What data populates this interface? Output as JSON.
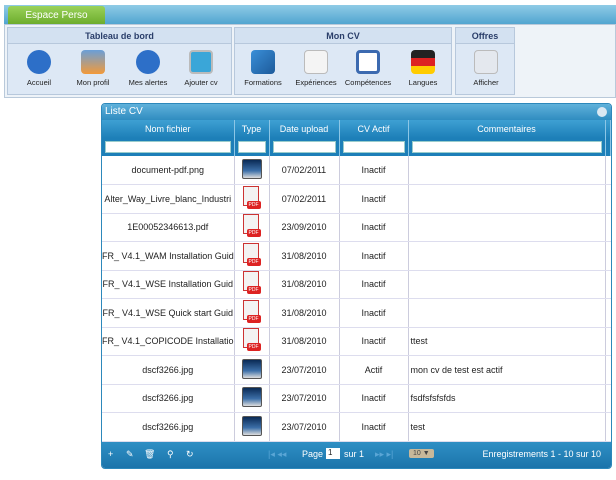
{
  "tab": "Espace Perso",
  "groups": [
    {
      "title": "Tableau de bord",
      "buttons": [
        "Accueil",
        "Mon profil",
        "Mes alertes",
        "Ajouter cv"
      ]
    },
    {
      "title": "Mon CV",
      "buttons": [
        "Formations",
        "Expériences",
        "Compétences",
        "Langues"
      ]
    },
    {
      "title": "Offres",
      "buttons": [
        "Afficher"
      ]
    }
  ],
  "grid": {
    "title": "Liste CV",
    "columns": [
      "Nom fichier",
      "Type",
      "Date upload",
      "CV Actif",
      "Commentaires"
    ],
    "rows": [
      {
        "name": "document-pdf.png",
        "type": "image",
        "date": "07/02/2011",
        "actif": "Inactif",
        "comment": ""
      },
      {
        "name": "Alter_Way_Livre_blanc_Industri",
        "type": "pdf",
        "date": "07/02/2011",
        "actif": "Inactif",
        "comment": ""
      },
      {
        "name": "1E00052346613.pdf",
        "type": "pdf",
        "date": "23/09/2010",
        "actif": "Inactif",
        "comment": ""
      },
      {
        "name": "FR_ V4.1_WAM Installation Guid",
        "type": "pdf",
        "date": "31/08/2010",
        "actif": "Inactif",
        "comment": ""
      },
      {
        "name": "FR_ V4.1_WSE Installation Guid",
        "type": "pdf",
        "date": "31/08/2010",
        "actif": "Inactif",
        "comment": ""
      },
      {
        "name": "FR_ V4.1_WSE Quick start Guid",
        "type": "pdf",
        "date": "31/08/2010",
        "actif": "Inactif",
        "comment": ""
      },
      {
        "name": "FR_ V4.1_COPICODE Installatio",
        "type": "pdf",
        "date": "31/08/2010",
        "actif": "Inactif",
        "comment": "ttest"
      },
      {
        "name": "dscf3266.jpg",
        "type": "image",
        "date": "23/07/2010",
        "actif": "Actif",
        "comment": "mon cv de test est actif"
      },
      {
        "name": "dscf3266.jpg",
        "type": "image",
        "date": "23/07/2010",
        "actif": "Inactif",
        "comment": "fsdfsfsfsfds"
      },
      {
        "name": "dscf3266.jpg",
        "type": "image",
        "date": "23/07/2010",
        "actif": "Inactif",
        "comment": "test"
      }
    ],
    "pager": {
      "page_label": "Page",
      "page": "1",
      "of_label": "sur 1",
      "rows_per_page": "10",
      "records": "Enregistrements 1 - 10 sur 10"
    }
  }
}
